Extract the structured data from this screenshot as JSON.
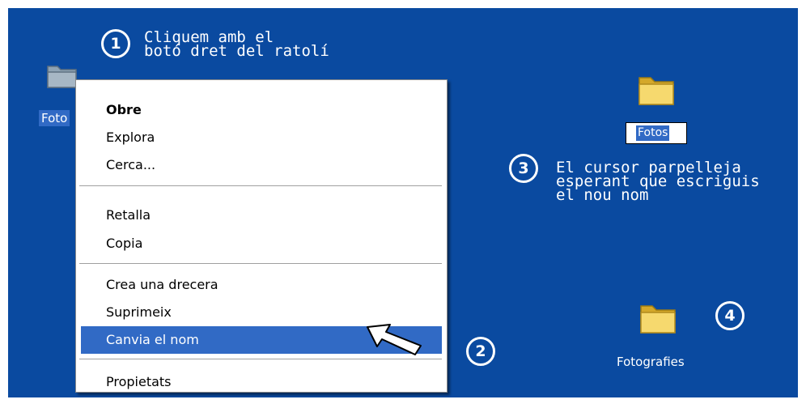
{
  "desktop": {
    "left_icon": {
      "label": "Foto"
    },
    "right_icon": {
      "label": "Fotos"
    },
    "bottom_icon": {
      "label": "Fotografies"
    }
  },
  "steps": [
    {
      "number": "1",
      "text": "Cliquem amb el\nbotó dret del ratolí"
    },
    {
      "number": "2",
      "text": ""
    },
    {
      "number": "3",
      "text": "El cursor parpelleja\nesperant que escriguis\nel nou nom"
    },
    {
      "number": "4",
      "text": ""
    }
  ],
  "context_menu": {
    "items": [
      {
        "label": "Obre",
        "bold": true
      },
      {
        "label": "Explora"
      },
      {
        "label": "Cerca..."
      },
      {
        "label": "Retalla"
      },
      {
        "label": "Copia"
      },
      {
        "label": "Crea una drecera"
      },
      {
        "label": "Suprimeix"
      },
      {
        "label": "Canvia el nom",
        "selected": true
      },
      {
        "label": "Propietats"
      }
    ]
  },
  "colors": {
    "desktop": "#0a4aa0",
    "selection": "#316ac5",
    "folder": "#f4d46a"
  },
  "icons": {
    "folder": "folder-icon",
    "cursor": "mouse-pointer-icon"
  }
}
